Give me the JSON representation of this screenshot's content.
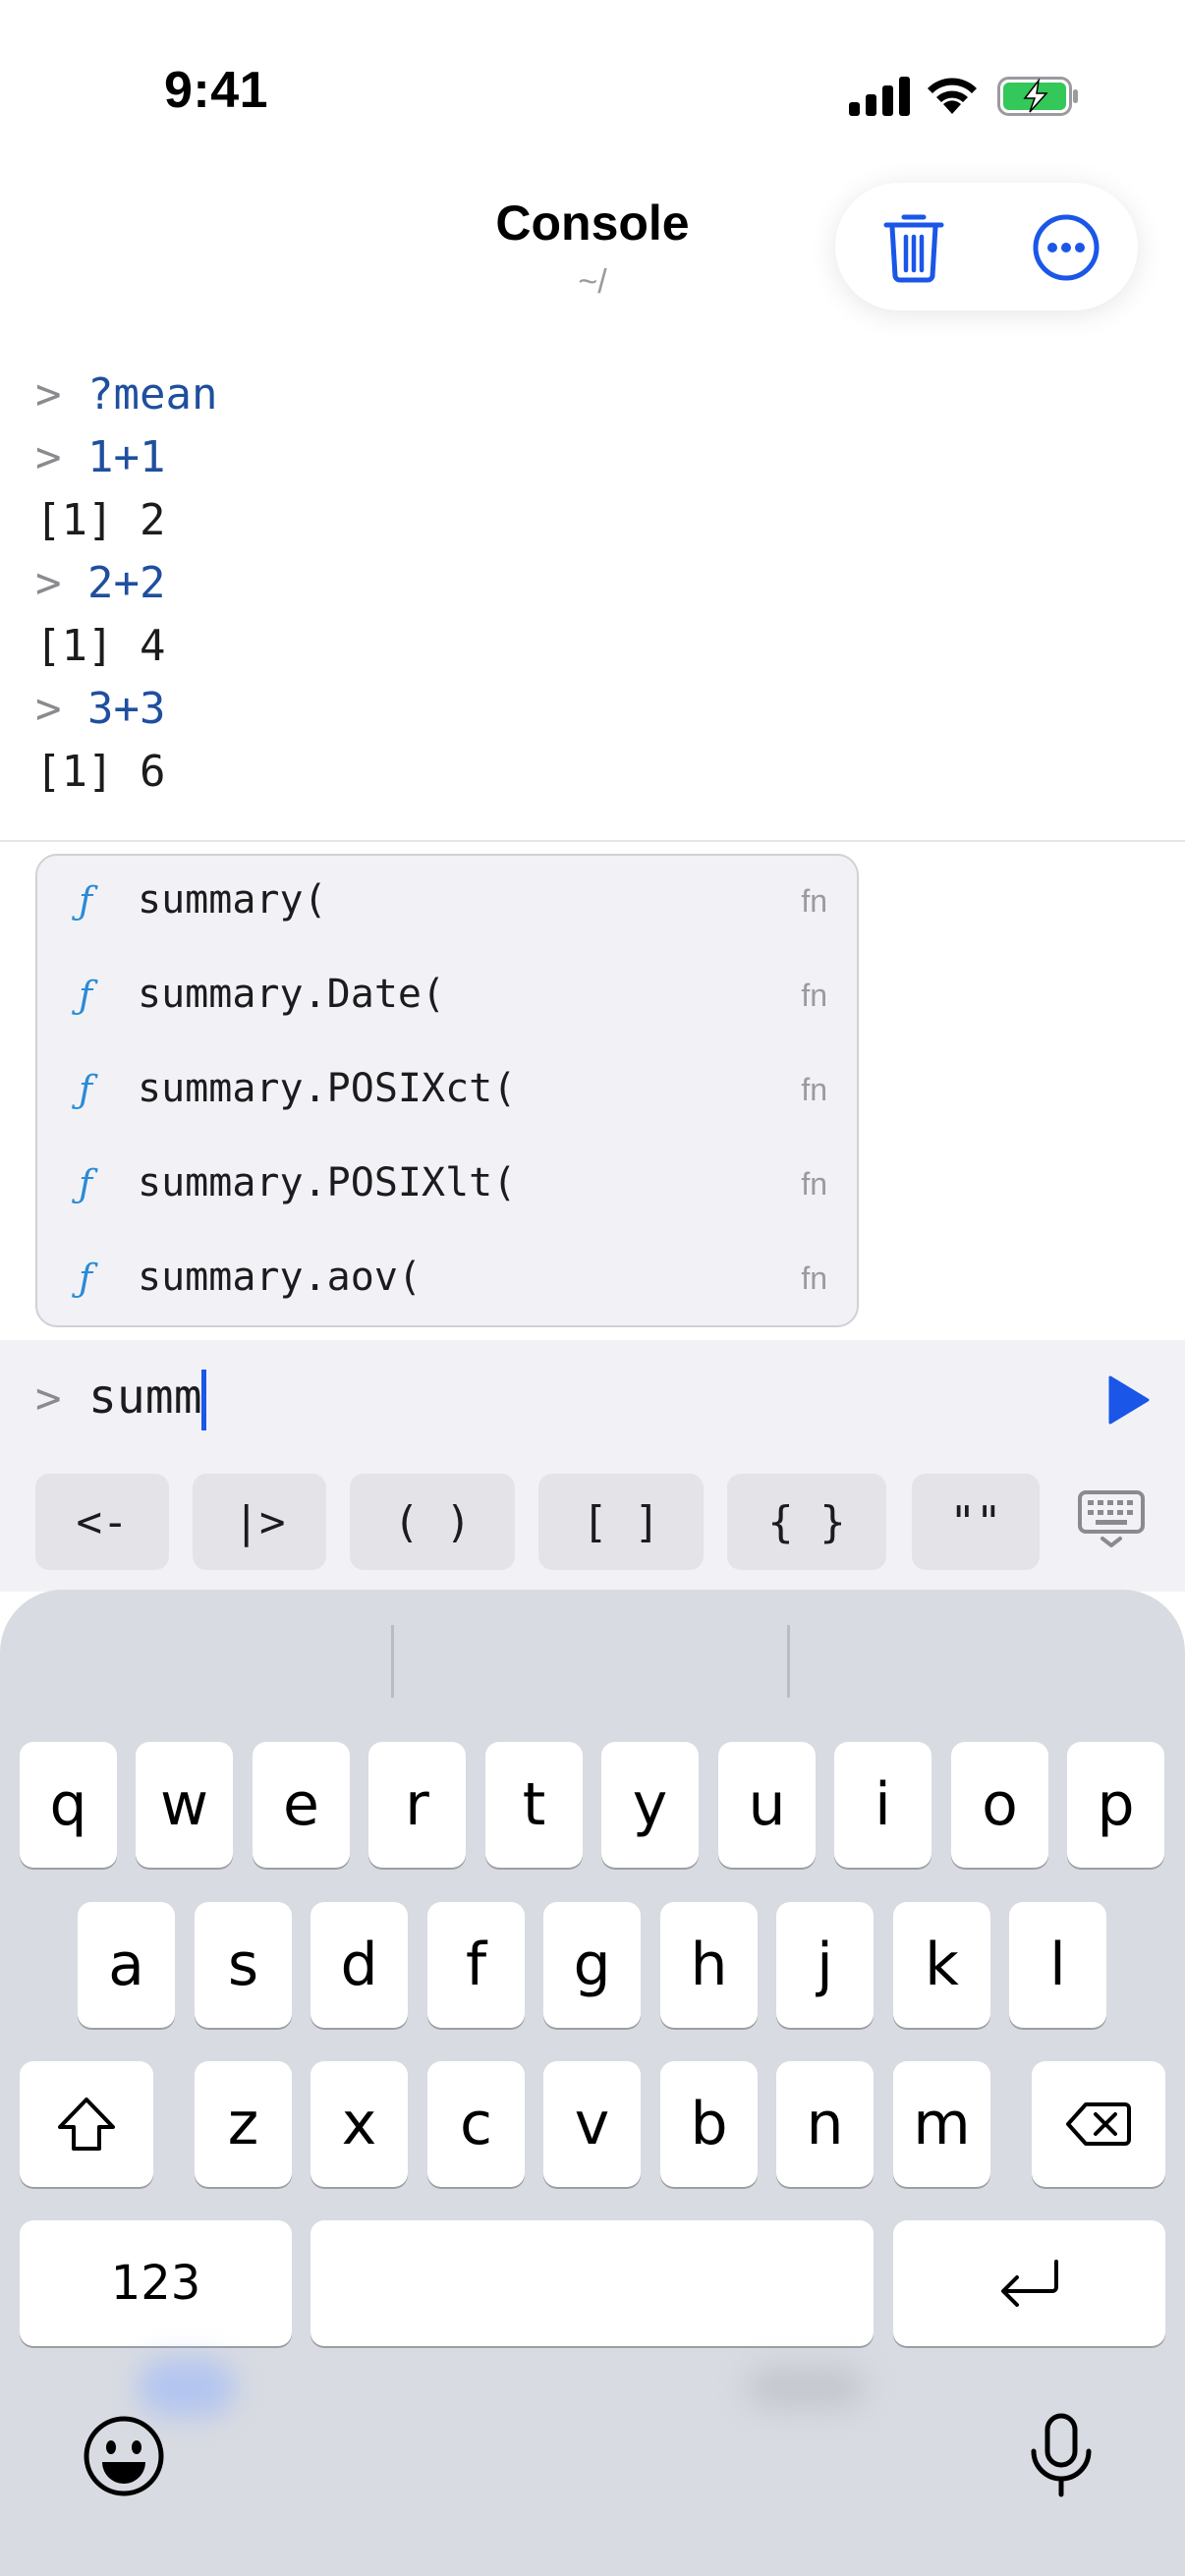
{
  "status": {
    "time": "9:41",
    "icons": [
      "cellular-signal-icon",
      "wifi-icon",
      "battery-charging-icon"
    ]
  },
  "header": {
    "title": "Console",
    "subtitle": "~/",
    "actions": [
      "trash-icon",
      "more-icon"
    ]
  },
  "console": {
    "prompt_symbol": ">",
    "lines": [
      {
        "type": "input",
        "prompt": ">",
        "text": "?mean"
      },
      {
        "type": "input",
        "prompt": ">",
        "text": "1+1"
      },
      {
        "type": "output",
        "text": "[1] 2"
      },
      {
        "type": "input",
        "prompt": ">",
        "text": "2+2"
      },
      {
        "type": "output",
        "text": "[1] 4"
      },
      {
        "type": "input",
        "prompt": ">",
        "text": "3+3"
      },
      {
        "type": "output",
        "text": "[1] 6"
      }
    ]
  },
  "autocomplete": {
    "icon_glyph": "ƒ",
    "items": [
      {
        "label": "summary(",
        "kind": "fn"
      },
      {
        "label": "summary.Date(",
        "kind": "fn"
      },
      {
        "label": "summary.POSIXct(",
        "kind": "fn"
      },
      {
        "label": "summary.POSIXlt(",
        "kind": "fn"
      },
      {
        "label": "summary.aov(",
        "kind": "fn"
      }
    ]
  },
  "input": {
    "prompt": ">",
    "value": "summ"
  },
  "shortcuts": [
    "<-",
    "|>",
    "( )",
    "[ ]",
    "{ }",
    "\"\""
  ],
  "keyboard": {
    "row1": [
      "q",
      "w",
      "e",
      "r",
      "t",
      "y",
      "u",
      "i",
      "o",
      "p"
    ],
    "row2": [
      "a",
      "s",
      "d",
      "f",
      "g",
      "h",
      "j",
      "k",
      "l"
    ],
    "row3": [
      "z",
      "x",
      "c",
      "v",
      "b",
      "n",
      "m"
    ],
    "numbers_label": "123"
  },
  "colors": {
    "accent": "#1a56e8",
    "command_text": "#1f4f9e",
    "function_icon": "#2a8bd6",
    "battery_green": "#34c759"
  }
}
